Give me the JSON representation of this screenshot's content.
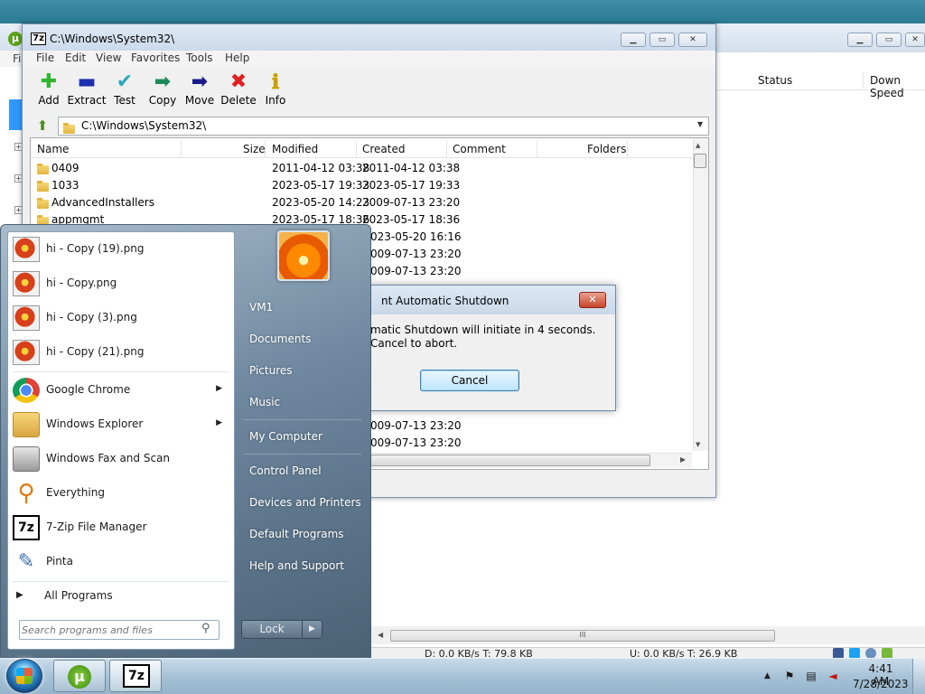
{
  "utorrent": {
    "menu_first_letters": "Fi",
    "columns": [
      "Status",
      "Down Speed"
    ],
    "status_down": "D: 0.0 KB/s T: 79.8 KB",
    "status_up": "U: 0.0 KB/s T: 26.9 KB",
    "scroll_grip": "III",
    "logo_icon": "utorrent-icon"
  },
  "zip": {
    "title": "C:\\Windows\\System32\\",
    "menu": [
      "File",
      "Edit",
      "View",
      "Favorites",
      "Tools",
      "Help"
    ],
    "toolbar": [
      {
        "label": "Add",
        "icon": "plus-icon",
        "color": "#2fb52f"
      },
      {
        "label": "Extract",
        "icon": "minus-icon",
        "color": "#1d2fb0"
      },
      {
        "label": "Test",
        "icon": "check-icon",
        "color": "#2ea6b8"
      },
      {
        "label": "Copy",
        "icon": "copy-arrow-icon",
        "color": "#1c8a5a"
      },
      {
        "label": "Move",
        "icon": "move-arrow-icon",
        "color": "#1a1a8a"
      },
      {
        "label": "Delete",
        "icon": "x-icon",
        "color": "#e02020"
      },
      {
        "label": "Info",
        "icon": "info-icon",
        "color": "#c7a000"
      }
    ],
    "address": "C:\\Windows\\System32\\",
    "columns": [
      "Name",
      "Size",
      "Modified",
      "Created",
      "Comment",
      "Folders"
    ],
    "rows": [
      {
        "name": "0409",
        "modified": "2011-04-12 03:38",
        "created": "2011-04-12 03:38"
      },
      {
        "name": "1033",
        "modified": "2023-05-17 19:33",
        "created": "2023-05-17 19:33"
      },
      {
        "name": "AdvancedInstallers",
        "modified": "2023-05-20 14:23",
        "created": "2009-07-13 23:20"
      },
      {
        "name": "appmgmt",
        "modified": "2023-05-17 18:36",
        "created": "2023-05-17 18:36"
      }
    ],
    "partial_created": [
      "023-05-20 16:16",
      "009-07-13 23:20",
      "009-07-13 23:20",
      "009-07-13 23:20",
      "009-07-13 23:20"
    ]
  },
  "dialog": {
    "title": "nt Automatic Shutdown",
    "line1": "matic Shutdown will initiate in 4 seconds.",
    "line2": "Cancel to abort.",
    "cancel": "Cancel"
  },
  "startmenu": {
    "recent": [
      {
        "label": "hi - Copy (19).png"
      },
      {
        "label": "hi - Copy.png"
      },
      {
        "label": "hi - Copy (3).png"
      },
      {
        "label": "hi - Copy (21).png"
      }
    ],
    "programs": [
      {
        "label": "Google Chrome",
        "icon": "chrome-icon",
        "submenu": true
      },
      {
        "label": "Windows Explorer",
        "icon": "explorer-icon",
        "submenu": true
      },
      {
        "label": "Windows Fax and Scan",
        "icon": "fax-icon",
        "submenu": false
      },
      {
        "label": "Everything",
        "icon": "magnifier-icon",
        "submenu": false
      },
      {
        "label": "7-Zip File Manager",
        "icon": "7zip-icon",
        "submenu": false
      },
      {
        "label": "Pinta",
        "icon": "pinta-icon",
        "submenu": false
      }
    ],
    "all_programs": "All Programs",
    "search_placeholder": "Search programs and files",
    "right": [
      "VM1",
      "Documents",
      "Pictures",
      "Music",
      "My Computer",
      "Control Panel",
      "Devices and Printers",
      "Default Programs",
      "Help and Support"
    ],
    "lock": "Lock"
  },
  "taskbar": {
    "time": "4:41 AM",
    "date": "7/28/2023",
    "zip_label": "7z",
    "ut_label": "µ"
  }
}
